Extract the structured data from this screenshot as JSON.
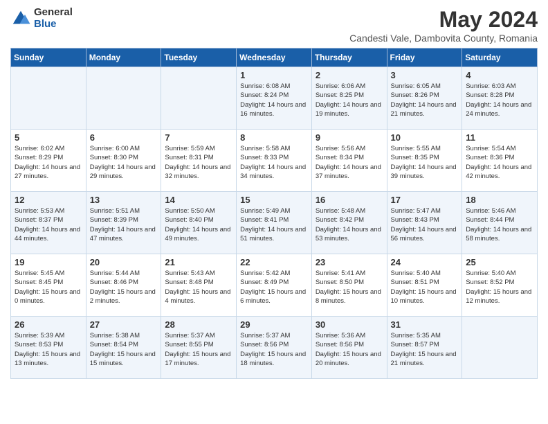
{
  "header": {
    "logo_general": "General",
    "logo_blue": "Blue",
    "month_title": "May 2024",
    "subtitle": "Candesti Vale, Dambovita County, Romania"
  },
  "days_of_week": [
    "Sunday",
    "Monday",
    "Tuesday",
    "Wednesday",
    "Thursday",
    "Friday",
    "Saturday"
  ],
  "weeks": [
    [
      {
        "day": "",
        "info": ""
      },
      {
        "day": "",
        "info": ""
      },
      {
        "day": "",
        "info": ""
      },
      {
        "day": "1",
        "info": "Sunrise: 6:08 AM\nSunset: 8:24 PM\nDaylight: 14 hours and 16 minutes."
      },
      {
        "day": "2",
        "info": "Sunrise: 6:06 AM\nSunset: 8:25 PM\nDaylight: 14 hours and 19 minutes."
      },
      {
        "day": "3",
        "info": "Sunrise: 6:05 AM\nSunset: 8:26 PM\nDaylight: 14 hours and 21 minutes."
      },
      {
        "day": "4",
        "info": "Sunrise: 6:03 AM\nSunset: 8:28 PM\nDaylight: 14 hours and 24 minutes."
      }
    ],
    [
      {
        "day": "5",
        "info": "Sunrise: 6:02 AM\nSunset: 8:29 PM\nDaylight: 14 hours and 27 minutes."
      },
      {
        "day": "6",
        "info": "Sunrise: 6:00 AM\nSunset: 8:30 PM\nDaylight: 14 hours and 29 minutes."
      },
      {
        "day": "7",
        "info": "Sunrise: 5:59 AM\nSunset: 8:31 PM\nDaylight: 14 hours and 32 minutes."
      },
      {
        "day": "8",
        "info": "Sunrise: 5:58 AM\nSunset: 8:33 PM\nDaylight: 14 hours and 34 minutes."
      },
      {
        "day": "9",
        "info": "Sunrise: 5:56 AM\nSunset: 8:34 PM\nDaylight: 14 hours and 37 minutes."
      },
      {
        "day": "10",
        "info": "Sunrise: 5:55 AM\nSunset: 8:35 PM\nDaylight: 14 hours and 39 minutes."
      },
      {
        "day": "11",
        "info": "Sunrise: 5:54 AM\nSunset: 8:36 PM\nDaylight: 14 hours and 42 minutes."
      }
    ],
    [
      {
        "day": "12",
        "info": "Sunrise: 5:53 AM\nSunset: 8:37 PM\nDaylight: 14 hours and 44 minutes."
      },
      {
        "day": "13",
        "info": "Sunrise: 5:51 AM\nSunset: 8:39 PM\nDaylight: 14 hours and 47 minutes."
      },
      {
        "day": "14",
        "info": "Sunrise: 5:50 AM\nSunset: 8:40 PM\nDaylight: 14 hours and 49 minutes."
      },
      {
        "day": "15",
        "info": "Sunrise: 5:49 AM\nSunset: 8:41 PM\nDaylight: 14 hours and 51 minutes."
      },
      {
        "day": "16",
        "info": "Sunrise: 5:48 AM\nSunset: 8:42 PM\nDaylight: 14 hours and 53 minutes."
      },
      {
        "day": "17",
        "info": "Sunrise: 5:47 AM\nSunset: 8:43 PM\nDaylight: 14 hours and 56 minutes."
      },
      {
        "day": "18",
        "info": "Sunrise: 5:46 AM\nSunset: 8:44 PM\nDaylight: 14 hours and 58 minutes."
      }
    ],
    [
      {
        "day": "19",
        "info": "Sunrise: 5:45 AM\nSunset: 8:45 PM\nDaylight: 15 hours and 0 minutes."
      },
      {
        "day": "20",
        "info": "Sunrise: 5:44 AM\nSunset: 8:46 PM\nDaylight: 15 hours and 2 minutes."
      },
      {
        "day": "21",
        "info": "Sunrise: 5:43 AM\nSunset: 8:48 PM\nDaylight: 15 hours and 4 minutes."
      },
      {
        "day": "22",
        "info": "Sunrise: 5:42 AM\nSunset: 8:49 PM\nDaylight: 15 hours and 6 minutes."
      },
      {
        "day": "23",
        "info": "Sunrise: 5:41 AM\nSunset: 8:50 PM\nDaylight: 15 hours and 8 minutes."
      },
      {
        "day": "24",
        "info": "Sunrise: 5:40 AM\nSunset: 8:51 PM\nDaylight: 15 hours and 10 minutes."
      },
      {
        "day": "25",
        "info": "Sunrise: 5:40 AM\nSunset: 8:52 PM\nDaylight: 15 hours and 12 minutes."
      }
    ],
    [
      {
        "day": "26",
        "info": "Sunrise: 5:39 AM\nSunset: 8:53 PM\nDaylight: 15 hours and 13 minutes."
      },
      {
        "day": "27",
        "info": "Sunrise: 5:38 AM\nSunset: 8:54 PM\nDaylight: 15 hours and 15 minutes."
      },
      {
        "day": "28",
        "info": "Sunrise: 5:37 AM\nSunset: 8:55 PM\nDaylight: 15 hours and 17 minutes."
      },
      {
        "day": "29",
        "info": "Sunrise: 5:37 AM\nSunset: 8:56 PM\nDaylight: 15 hours and 18 minutes."
      },
      {
        "day": "30",
        "info": "Sunrise: 5:36 AM\nSunset: 8:56 PM\nDaylight: 15 hours and 20 minutes."
      },
      {
        "day": "31",
        "info": "Sunrise: 5:35 AM\nSunset: 8:57 PM\nDaylight: 15 hours and 21 minutes."
      },
      {
        "day": "",
        "info": ""
      }
    ]
  ]
}
